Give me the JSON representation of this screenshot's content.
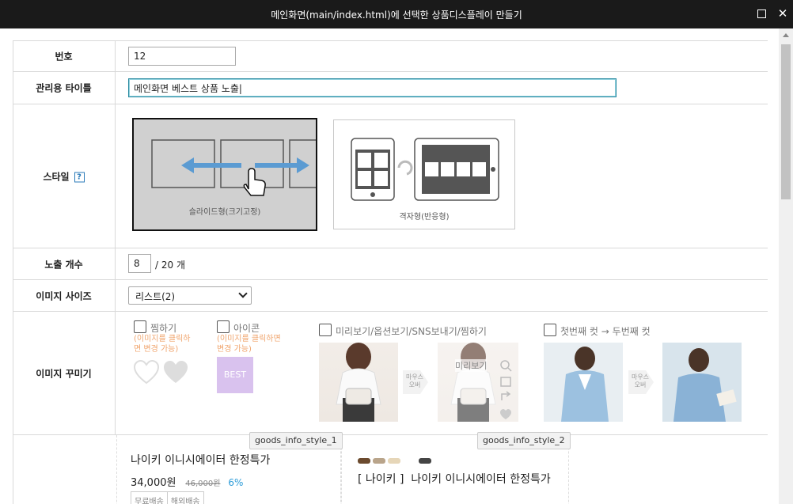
{
  "window": {
    "title": "메인화면(main/index.html)에 선택한 상품디스플레이 만들기",
    "maximize_icon": "maximize-icon",
    "close_icon": "close-icon",
    "close_glyph": "✕"
  },
  "form": {
    "number": {
      "label": "번호",
      "value": "12"
    },
    "admin_title": {
      "label": "관리용 타이틀",
      "value": "메인화면 베스트 상품 노출|"
    },
    "style": {
      "label": "스타일",
      "help_glyph": "?",
      "options": [
        {
          "label": "슬라이드형(크기고정)",
          "selected": true
        },
        {
          "label": "격자형(반응형)",
          "selected": false
        }
      ]
    },
    "display_count": {
      "label": "노출 개수",
      "value": "8",
      "suffix": "/ 20 개"
    },
    "image_size": {
      "label": "이미지 사이즈",
      "selected": "리스트(2)"
    },
    "image_decoration": {
      "label": "이미지 꾸미기",
      "options": [
        {
          "label": "찜하기",
          "note": "(이미지를 클릭하면 변경 가능)"
        },
        {
          "label": "아이콘",
          "note": "(이미지를 클릭하면 변경 가능)",
          "badge": "BEST"
        },
        {
          "label": "미리보기/옵션보기/SNS보내기/찜하기",
          "overlay_label": "미리보기",
          "mouse_over": "마우스 오버"
        },
        {
          "label": "첫번째 컷 → 두번째 컷",
          "mouse_over": "마우스 오버"
        }
      ]
    }
  },
  "goods_styles": [
    {
      "tooltip": "goods_info_style_1",
      "name": "나이키 이니시에이터 한정특가",
      "price": "34,000원",
      "original_price": "46,000원",
      "discount": "6%",
      "tags": [
        "무료배송",
        "해외배송"
      ]
    },
    {
      "tooltip": "goods_info_style_2",
      "brand": "[ 나이키 ]",
      "name": "나이키 이니시에이터 한정특가",
      "swatches": [
        "#6b4a2e",
        "#b9a48a",
        "#e6d6b8",
        "#444444"
      ]
    }
  ],
  "colors": {
    "accent": "#2a8aa0",
    "discount": "#2a9bd8",
    "note": "#f0a56e",
    "badge_bg": "#d9c2ee"
  }
}
